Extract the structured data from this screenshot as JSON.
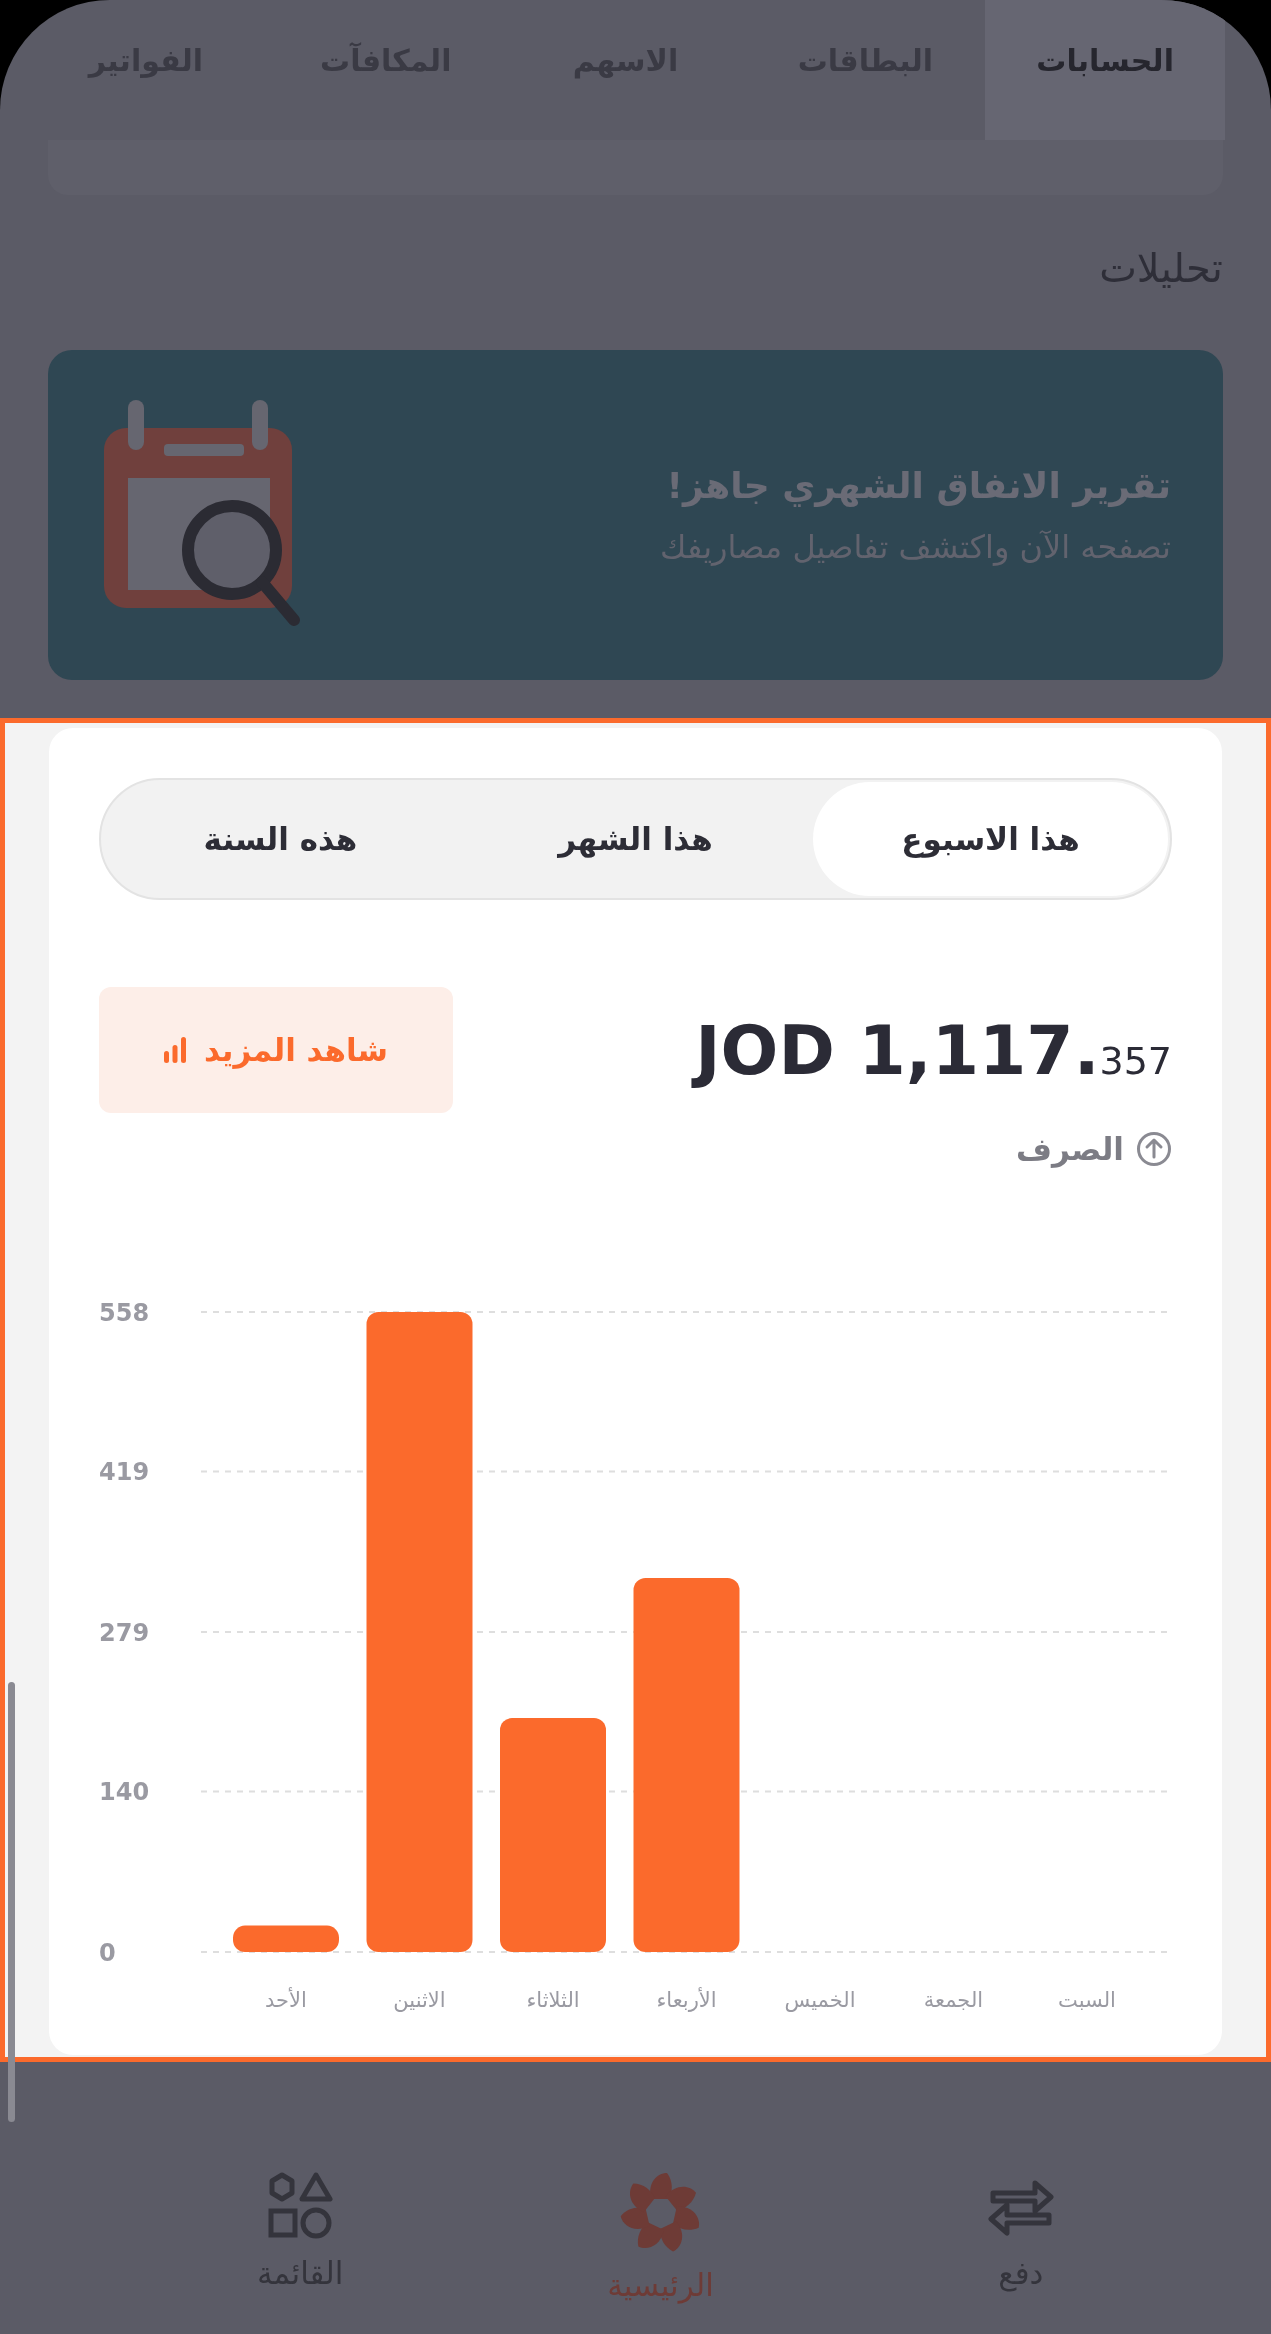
{
  "tabs": [
    {
      "label": "الحسابات",
      "selected": true
    },
    {
      "label": "البطاقات",
      "selected": false
    },
    {
      "label": "الاسهم",
      "selected": false
    },
    {
      "label": "المكافآت",
      "selected": false
    },
    {
      "label": "الفواتير",
      "selected": false
    }
  ],
  "section_title": "تحليلات",
  "banner": {
    "title": "تقرير الانفاق الشهري جاهز!",
    "subtitle": "تصفحه الآن واكتشف تفاصيل مصاريفك"
  },
  "period_tabs": [
    {
      "label": "هذا الاسبوع",
      "selected": true
    },
    {
      "label": "هذا الشهر",
      "selected": false
    },
    {
      "label": "هذه السنة",
      "selected": false
    }
  ],
  "amount": {
    "main": "JOD 1,117.",
    "fraction": "357"
  },
  "more_button": "شاهد المزيد",
  "amount_label": "الصرف",
  "chart_data": {
    "type": "bar",
    "categories": [
      "الأحد",
      "الاثنين",
      "الثلاثاء",
      "الأربعاء",
      "الخميس",
      "الجمعة",
      "السبت"
    ],
    "values": [
      23,
      558,
      204,
      326,
      0,
      0,
      0
    ],
    "ylim": [
      0,
      558
    ],
    "yticks": [
      0,
      140,
      279,
      419,
      558
    ],
    "grid": true
  },
  "bottom_nav": [
    {
      "kind": "transfer",
      "label": "دفع",
      "selected": false
    },
    {
      "kind": "home",
      "label": "الرئيسية",
      "selected": true
    },
    {
      "kind": "menu",
      "label": "القائمة",
      "selected": false
    }
  ]
}
